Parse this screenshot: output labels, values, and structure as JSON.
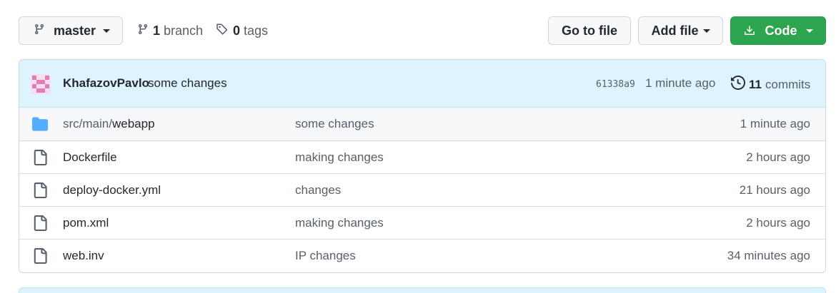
{
  "toolbar": {
    "branch_name": "master",
    "branch_count": "1",
    "branch_word": "branch",
    "tag_count": "0",
    "tag_word": "tags",
    "goto_file_label": "Go to file",
    "add_file_label": "Add file",
    "code_label": "Code"
  },
  "latest_commit": {
    "author": "KhafazovPavlo",
    "message": "some changes",
    "sha": "61338a9",
    "time": "1 minute ago",
    "commit_count": "11",
    "commit_word": "commits"
  },
  "files": [
    {
      "type": "folder",
      "name_prefix": "src/main/",
      "name": "webapp",
      "message": "some changes",
      "time": "1 minute ago"
    },
    {
      "type": "file",
      "name": "Dockerfile",
      "message": "making changes",
      "time": "2 hours ago"
    },
    {
      "type": "file",
      "name": "deploy-docker.yml",
      "message": "changes",
      "time": "21 hours ago"
    },
    {
      "type": "file",
      "name": "pom.xml",
      "message": "making changes",
      "time": "2 hours ago"
    },
    {
      "type": "file",
      "name": "web.inv",
      "message": "IP changes",
      "time": "34 minutes ago"
    }
  ],
  "colors": {
    "accent_green": "#2da44e",
    "header_blue": "#ddf4ff",
    "folder_blue": "#54aeff"
  },
  "icons": [
    "branch-icon",
    "tag-icon",
    "download-icon",
    "history-icon",
    "folder-icon",
    "file-icon",
    "avatar-identicon"
  ]
}
